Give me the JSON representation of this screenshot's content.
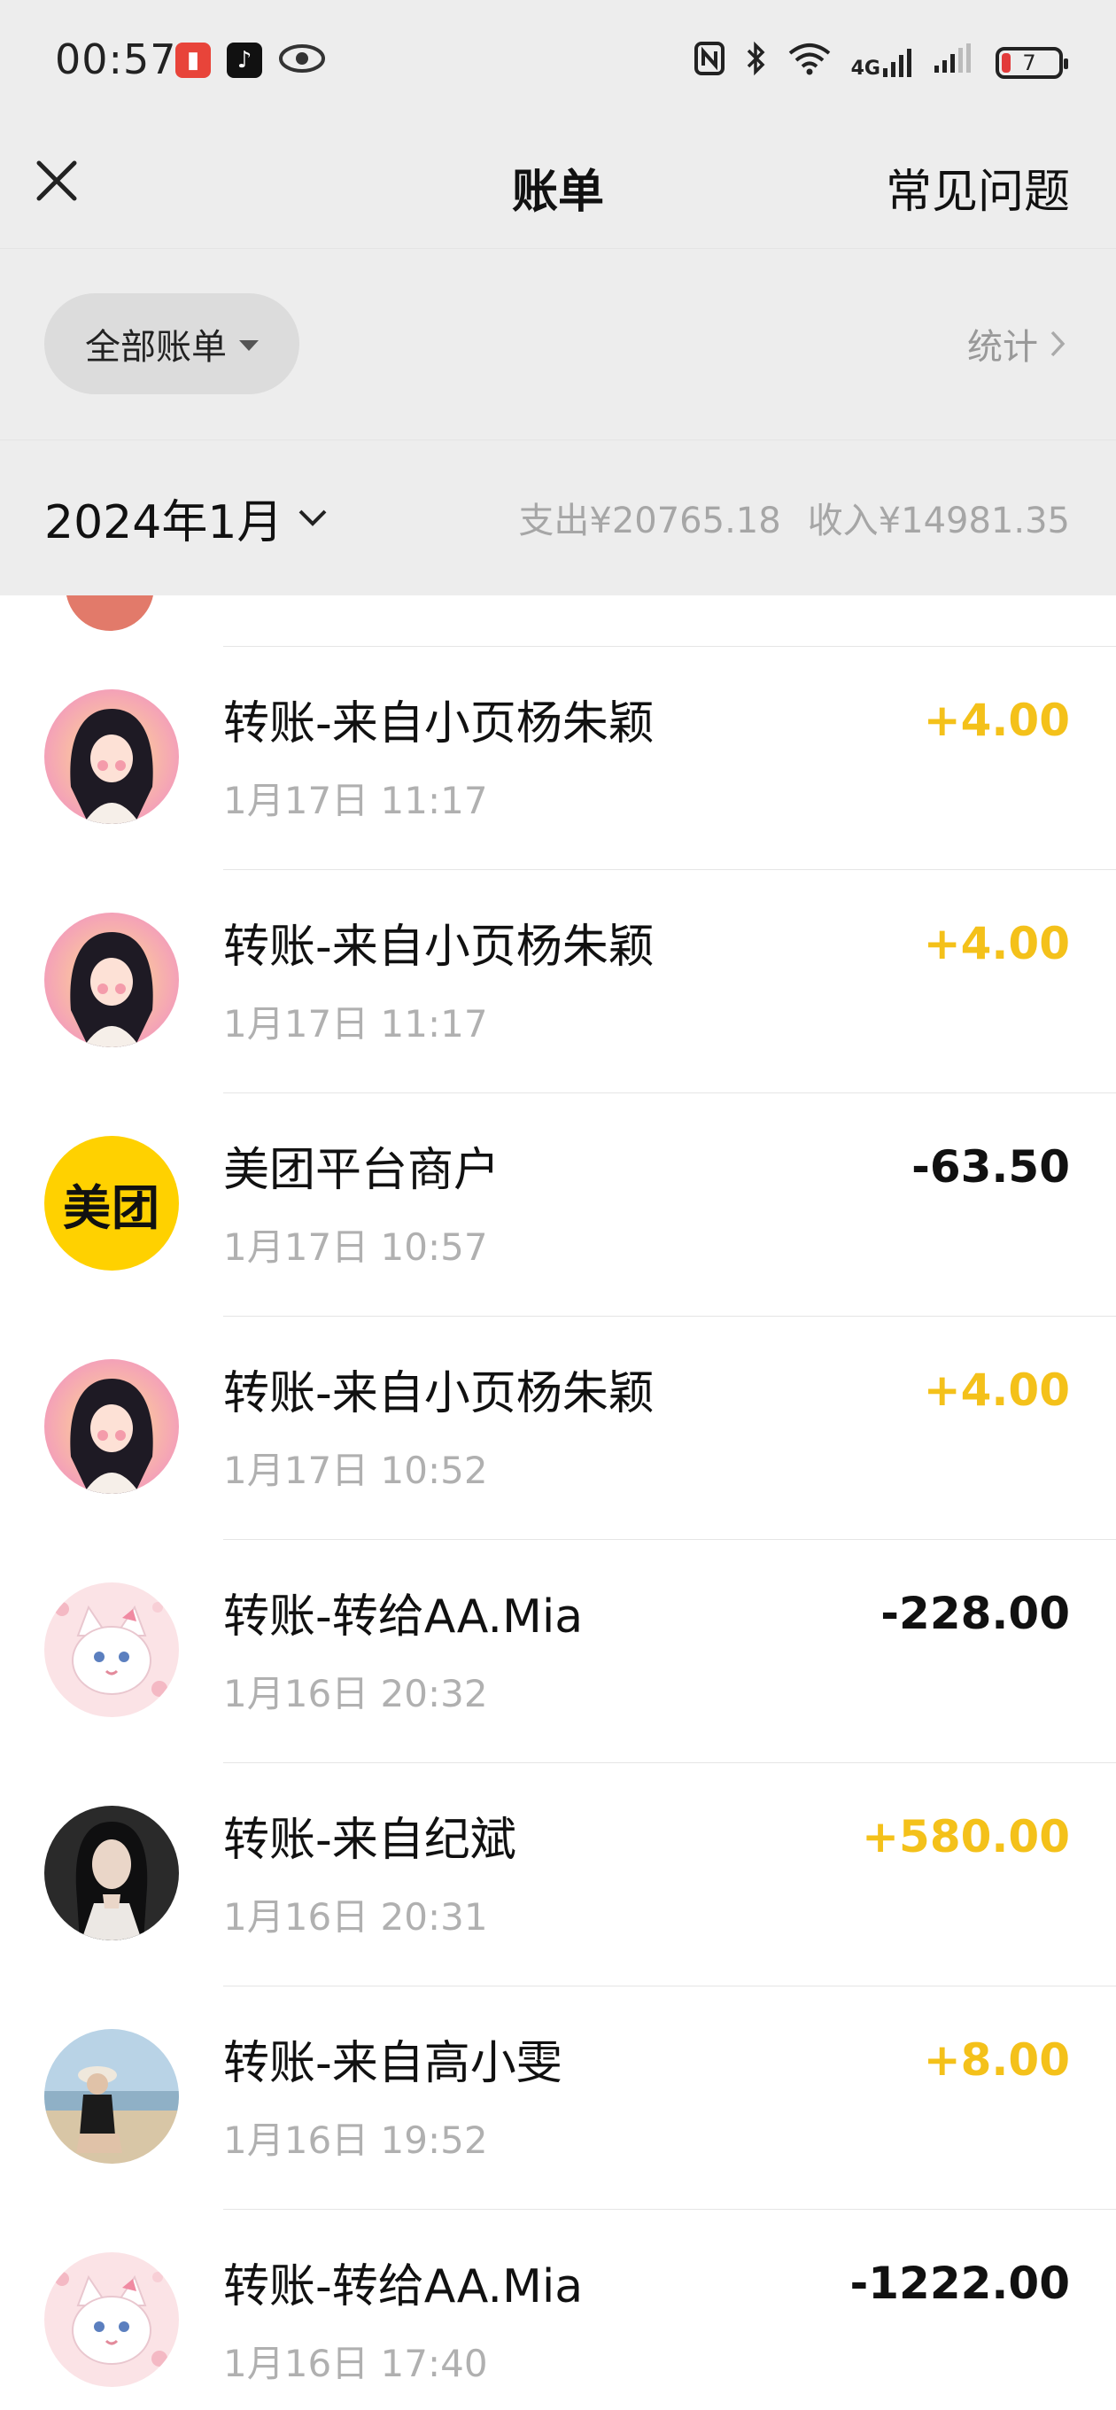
{
  "status_bar": {
    "time": "00:57",
    "network_label": "4G",
    "battery": "7",
    "icons": [
      "notification-app-icon",
      "tiktok-icon",
      "eye-icon",
      "nfc-icon",
      "bluetooth-icon",
      "wifi-icon",
      "cellular-signal-icon",
      "battery-icon"
    ]
  },
  "nav": {
    "title": "账单",
    "faq_label": "常见问题",
    "close_icon": "close-icon"
  },
  "filter": {
    "selected": "全部账单",
    "stats_label": "统计"
  },
  "month_header": {
    "month": "2024年1月",
    "expense": "支出¥20765.18",
    "income": "收入¥14981.35"
  },
  "transactions": [
    {
      "title": "转账-来自小页杨朱颖",
      "time": "1月17日 11:17",
      "amount": "+4.00",
      "type": "income",
      "avatar": "girl-illustration-avatar"
    },
    {
      "title": "转账-来自小页杨朱颖",
      "time": "1月17日 11:17",
      "amount": "+4.00",
      "type": "income",
      "avatar": "girl-illustration-avatar"
    },
    {
      "title": "美团平台商户",
      "time": "1月17日 10:57",
      "amount": "-63.50",
      "type": "expense",
      "avatar": "meituan-logo",
      "avatar_text": "美团"
    },
    {
      "title": "转账-来自小页杨朱颖",
      "time": "1月17日 10:52",
      "amount": "+4.00",
      "type": "income",
      "avatar": "girl-illustration-avatar"
    },
    {
      "title": "转账-转给AA.Mia",
      "time": "1月16日 20:32",
      "amount": "-228.00",
      "type": "expense",
      "avatar": "white-cat-avatar"
    },
    {
      "title": "转账-来自纪斌",
      "time": "1月16日 20:31",
      "amount": "+580.00",
      "type": "income",
      "avatar": "portrait-photo-avatar"
    },
    {
      "title": "转账-来自高小雯",
      "time": "1月16日 19:52",
      "amount": "+8.00",
      "type": "income",
      "avatar": "beach-photo-avatar"
    },
    {
      "title": "转账-转给AA.Mia",
      "time": "1月16日 17:40",
      "amount": "-1222.00",
      "type": "expense",
      "avatar": "white-cat-avatar"
    }
  ],
  "colors": {
    "header_bg": "#ededed",
    "income": "#f4c11a",
    "expense": "#111111",
    "secondary_text": "#b0b0b0",
    "meituan_yellow": "#ffd100"
  }
}
